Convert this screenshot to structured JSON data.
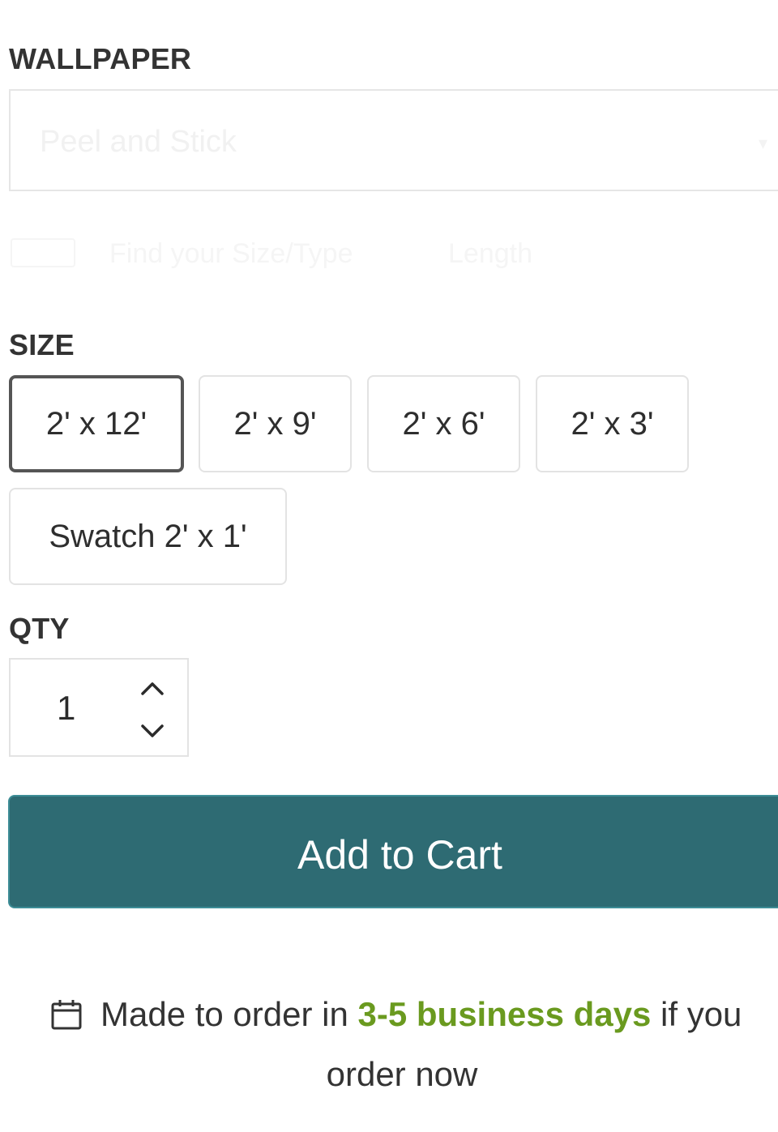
{
  "wallpaper": {
    "label": "WALLPAPER",
    "selected_value": "Peel and Stick"
  },
  "faded_row": {
    "text_1": "Find your Size/Type",
    "text_2": "Length"
  },
  "size": {
    "label": "SIZE",
    "options": [
      "2' x 12'",
      "2' x 9'",
      "2' x 6'",
      "2' x 3'",
      "Swatch 2' x 1'"
    ],
    "selected": "2' x 12'"
  },
  "qty": {
    "label": "QTY",
    "value": "1"
  },
  "cart": {
    "button_label": "Add to Cart"
  },
  "delivery": {
    "prefix": "Made to order in",
    "highlight": "3-5 business days",
    "suffix": "if you",
    "line2": "order now"
  },
  "colors": {
    "primary_button": "#2e6b73",
    "highlight_green": "#6a9a1f",
    "selected_border": "#555555"
  },
  "icons": [
    "chevron-down-icon",
    "chevron-up-icon",
    "calendar-icon"
  ]
}
